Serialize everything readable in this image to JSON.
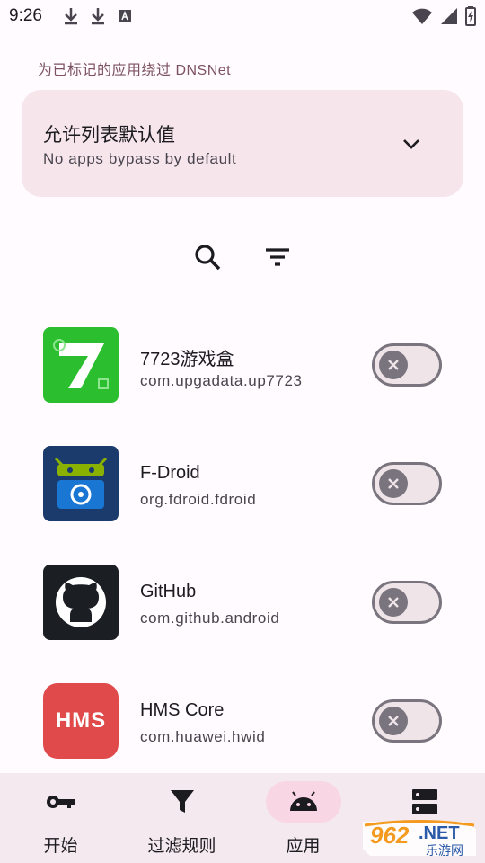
{
  "status_bar": {
    "time": "9:26"
  },
  "section_title": "为已标记的应用绕过 DNSNet",
  "mode": {
    "title": "允许列表默认值",
    "subtitle": "No apps bypass by default"
  },
  "toolbar": {
    "search_icon": "search-icon",
    "filter_icon": "filter-icon"
  },
  "apps": [
    {
      "name": "7723游戏盒",
      "package": "com.upgadata.up7723",
      "enabled": false,
      "icon_color": "#2bbf2f"
    },
    {
      "name": "F-Droid",
      "package": "org.fdroid.fdroid",
      "enabled": false,
      "icon_color": "#1a3b6b"
    },
    {
      "name": "GitHub",
      "package": "com.github.android",
      "enabled": false,
      "icon_color": "#1b1f24"
    },
    {
      "name": "HMS Core",
      "package": "com.huawei.hwid",
      "enabled": false,
      "icon_color": "#e04a4a",
      "icon_text": "HMS"
    }
  ],
  "nav": [
    {
      "label": "开始",
      "icon": "key-icon",
      "active": false
    },
    {
      "label": "过滤规则",
      "icon": "filter-funnel-icon",
      "active": false
    },
    {
      "label": "应用",
      "icon": "android-icon",
      "active": true
    },
    {
      "label": "",
      "icon": "dns-icon",
      "active": false
    }
  ],
  "watermark": {
    "number": "962",
    "suffix": ".NET",
    "sub": "乐游网"
  },
  "colors": {
    "accent": "#7d5260",
    "card": "#f6e5ea",
    "nav_bg": "#f4e9ee",
    "nav_active": "#f8d6e3"
  }
}
